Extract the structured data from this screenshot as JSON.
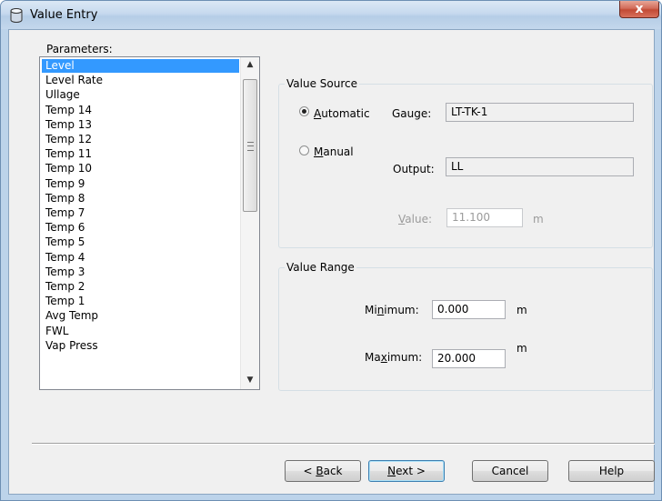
{
  "window": {
    "title": "Value Entry",
    "close_glyph": "x",
    "icon": "database-icon"
  },
  "parameters": {
    "label": "Parameters:",
    "items": [
      "Level",
      "Level Rate",
      "Ullage",
      "Temp 14",
      "Temp 13",
      "Temp 12",
      "Temp 11",
      "Temp 10",
      "Temp 9",
      "Temp 8",
      "Temp 7",
      "Temp 6",
      "Temp 5",
      "Temp 4",
      "Temp 3",
      "Temp 2",
      "Temp 1",
      "Avg Temp",
      "FWL",
      "Vap Press"
    ],
    "selected": "Level"
  },
  "value_source": {
    "legend": "Value Source",
    "automatic": {
      "label_pre": "",
      "label_key": "A",
      "label_post": "utomatic",
      "checked": true
    },
    "manual": {
      "label_pre": "",
      "label_key": "M",
      "label_post": "anual",
      "checked": false
    },
    "gauge": {
      "label": "Gauge:",
      "value": "LT-TK-1"
    },
    "output": {
      "label": "Output:",
      "value": "LL"
    },
    "value": {
      "label_pre": "",
      "label_key": "V",
      "label_post": "alue:",
      "value": "11.100",
      "unit": "m"
    }
  },
  "value_range": {
    "legend": "Value Range",
    "minimum": {
      "label_pre": "Mi",
      "label_key": "n",
      "label_post": "imum:",
      "value": "0.000",
      "unit": "m"
    },
    "maximum": {
      "label_pre": "Ma",
      "label_key": "x",
      "label_post": "imum:",
      "value": "20.000",
      "unit": "m"
    }
  },
  "buttons": {
    "back": {
      "pre": "< ",
      "key": "B",
      "post": "ack"
    },
    "next": {
      "pre": "",
      "key": "N",
      "post": "ext >"
    },
    "cancel": "Cancel",
    "help": "Help"
  }
}
